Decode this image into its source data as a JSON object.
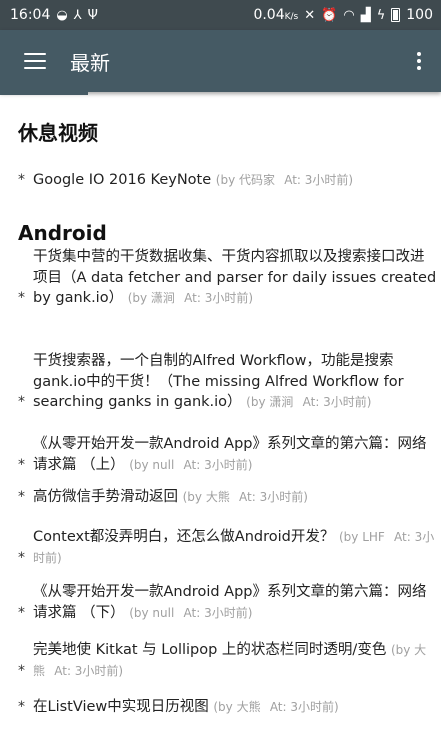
{
  "status": {
    "time": "16:04",
    "speed": "0.04",
    "speed_unit": "K/s",
    "battery": "100"
  },
  "appbar": {
    "title": "最新"
  },
  "sections": [
    {
      "title": "休息视频",
      "items": [
        {
          "text": "Google IO 2016 KeyNote",
          "author": "(by 代码家",
          "time": "At: 3小时前)"
        }
      ]
    },
    {
      "title": "Android",
      "items": [
        {
          "text": "干货集中营的干货数据收集、干货内容抓取以及搜索接口改进项目（A data fetcher and parser for daily issues created by gank.io）",
          "author": "(by 潇涧",
          "time": "At: 3小时前)"
        },
        {
          "text": "干货搜索器，一个自制的Alfred Workflow，功能是搜索gank.io中的干货！（The missing Alfred Workflow for searching ganks in gank.io）",
          "author": "(by 潇涧",
          "time": "At: 3小时前)"
        },
        {
          "text": "《从零开始开发一款Android App》系列文章的第六篇：网络请求篇 （上）",
          "author": "(by null",
          "time": "At: 3小时前)"
        },
        {
          "text": "高仿微信手势滑动返回",
          "author": "(by 大熊",
          "time": "At: 3小时前)"
        },
        {
          "text": "Context都没弄明白，还怎么做Android开发？",
          "author": "(by LHF",
          "time": "At: 3小时前)"
        },
        {
          "text": "《从零开始开发一款Android App》系列文章的第六篇：网络请求篇 （下）",
          "author": "(by null",
          "time": "At: 3小时前)"
        },
        {
          "text": "完美地使 Kitkat 与 Lollipop 上的状态栏同时透明/变色",
          "author": "(by 大熊",
          "time": "At: 3小时前)"
        },
        {
          "text": "在ListView中实现日历视图",
          "author": "(by 大熊",
          "time": "At: 3小时前)"
        }
      ]
    }
  ]
}
